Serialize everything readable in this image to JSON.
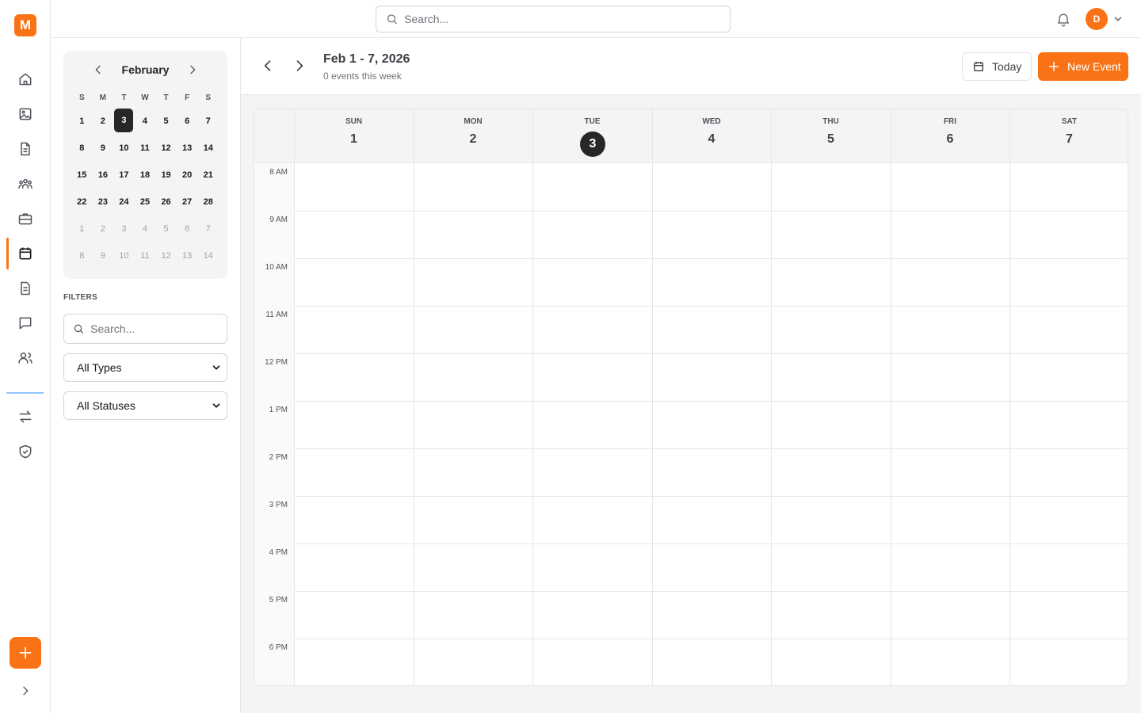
{
  "app": {
    "logo_letter": "M"
  },
  "rail": {
    "items": [
      {
        "name": "home-icon"
      },
      {
        "name": "image-icon"
      },
      {
        "name": "document-icon"
      },
      {
        "name": "team-icon"
      },
      {
        "name": "briefcase-icon"
      },
      {
        "name": "calendar-icon",
        "active": true
      },
      {
        "name": "file-text-icon"
      },
      {
        "name": "chat-icon"
      },
      {
        "name": "users-icon"
      },
      {
        "name": "transfer-icon"
      },
      {
        "name": "shield-check-icon"
      }
    ],
    "add_icon": "plus-icon",
    "expand_icon": "chevron-right-icon"
  },
  "topbar": {
    "search_placeholder": "Search...",
    "avatar_initial": "D"
  },
  "mini_calendar": {
    "month": "February",
    "weekdays": [
      "S",
      "M",
      "T",
      "W",
      "T",
      "F",
      "S"
    ],
    "days": [
      {
        "label": "1"
      },
      {
        "label": "2"
      },
      {
        "label": "3",
        "today": true
      },
      {
        "label": "4"
      },
      {
        "label": "5"
      },
      {
        "label": "6"
      },
      {
        "label": "7"
      },
      {
        "label": "8"
      },
      {
        "label": "9"
      },
      {
        "label": "10"
      },
      {
        "label": "11"
      },
      {
        "label": "12"
      },
      {
        "label": "13"
      },
      {
        "label": "14"
      },
      {
        "label": "15"
      },
      {
        "label": "16"
      },
      {
        "label": "17"
      },
      {
        "label": "18"
      },
      {
        "label": "19"
      },
      {
        "label": "20"
      },
      {
        "label": "21"
      },
      {
        "label": "22"
      },
      {
        "label": "23"
      },
      {
        "label": "24"
      },
      {
        "label": "25"
      },
      {
        "label": "26"
      },
      {
        "label": "27"
      },
      {
        "label": "28"
      },
      {
        "label": "1",
        "out": true
      },
      {
        "label": "2",
        "out": true
      },
      {
        "label": "3",
        "out": true
      },
      {
        "label": "4",
        "out": true
      },
      {
        "label": "5",
        "out": true
      },
      {
        "label": "6",
        "out": true
      },
      {
        "label": "7",
        "out": true
      },
      {
        "label": "8",
        "out": true
      },
      {
        "label": "9",
        "out": true
      },
      {
        "label": "10",
        "out": true
      },
      {
        "label": "11",
        "out": true
      },
      {
        "label": "12",
        "out": true
      },
      {
        "label": "13",
        "out": true
      },
      {
        "label": "14",
        "out": true
      }
    ]
  },
  "filters": {
    "label": "FILTERS",
    "search_placeholder": "Search...",
    "type_selected": "All Types",
    "status_selected": "All Statuses"
  },
  "header": {
    "range": "Feb 1 - 7, 2026",
    "event_count": "0 events this week",
    "today_label": "Today",
    "new_event_label": "New Event"
  },
  "week": {
    "days": [
      {
        "name": "SUN",
        "num": "1"
      },
      {
        "name": "MON",
        "num": "2"
      },
      {
        "name": "TUE",
        "num": "3",
        "today": true
      },
      {
        "name": "WED",
        "num": "4"
      },
      {
        "name": "THU",
        "num": "5"
      },
      {
        "name": "FRI",
        "num": "6"
      },
      {
        "name": "SAT",
        "num": "7"
      }
    ],
    "hours": [
      "8 AM",
      "9 AM",
      "10 AM",
      "11 AM",
      "12 PM",
      "1 PM",
      "2 PM",
      "3 PM",
      "4 PM",
      "5 PM",
      "6 PM"
    ]
  },
  "colors": {
    "accent": "#f97316",
    "today_badge": "#27272a"
  }
}
